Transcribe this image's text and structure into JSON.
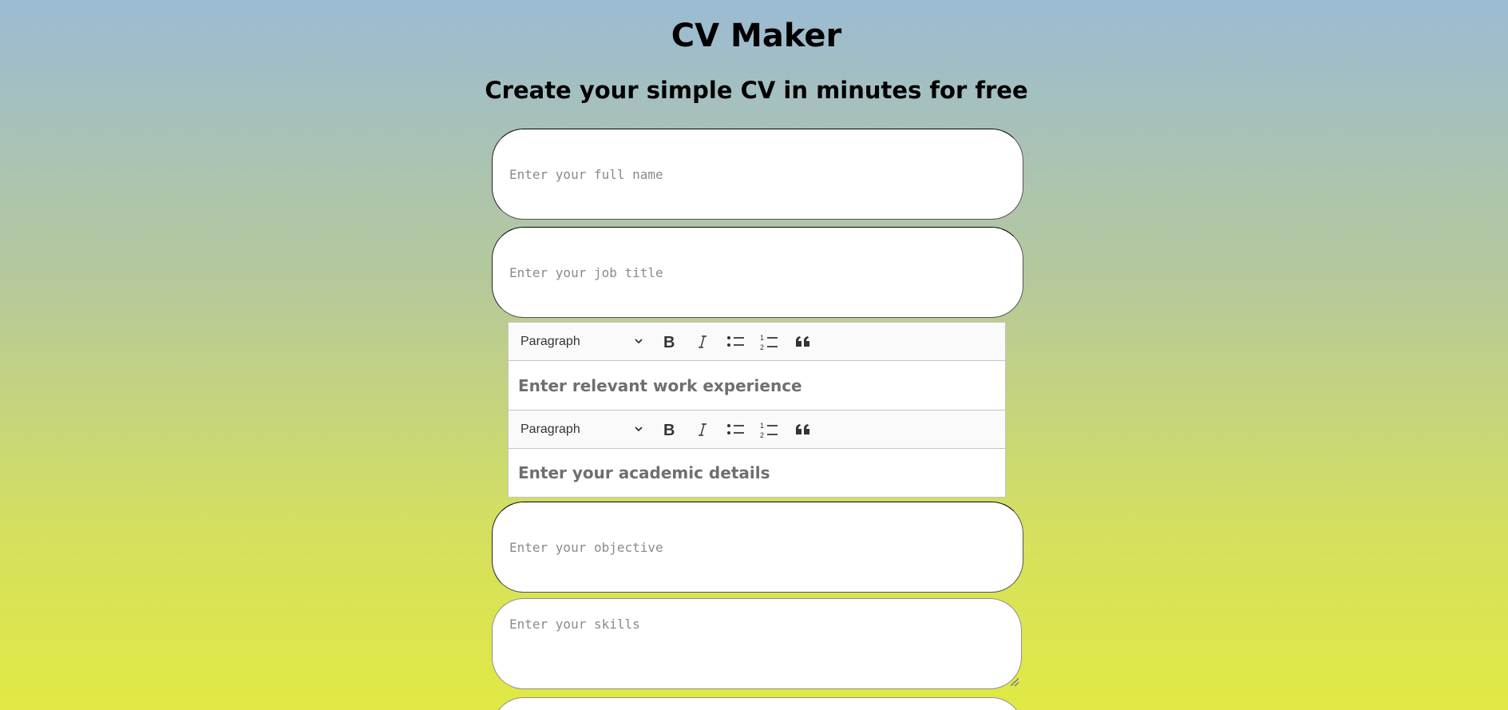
{
  "header": {
    "title": "CV Maker",
    "subtitle": "Create your simple CV in minutes for free"
  },
  "form": {
    "full_name_placeholder": "Enter your full name",
    "job_title_placeholder": "Enter your job title",
    "work_experience": {
      "heading_select": "Paragraph",
      "placeholder": "Enter relevant work experience",
      "toolbar_icons": [
        "bold-icon",
        "italic-icon",
        "bulleted-list-icon",
        "numbered-list-icon",
        "block-quote-icon"
      ]
    },
    "academic": {
      "heading_select": "Paragraph",
      "placeholder": "Enter your academic details",
      "toolbar_icons": [
        "bold-icon",
        "italic-icon",
        "bulleted-list-icon",
        "numbered-list-icon",
        "block-quote-icon"
      ]
    },
    "objective_placeholder": "Enter your objective",
    "skills_placeholder": "Enter your skills"
  },
  "colors": {
    "gradient_top": "#9bbbd3",
    "gradient_bottom": "#e1e944"
  }
}
